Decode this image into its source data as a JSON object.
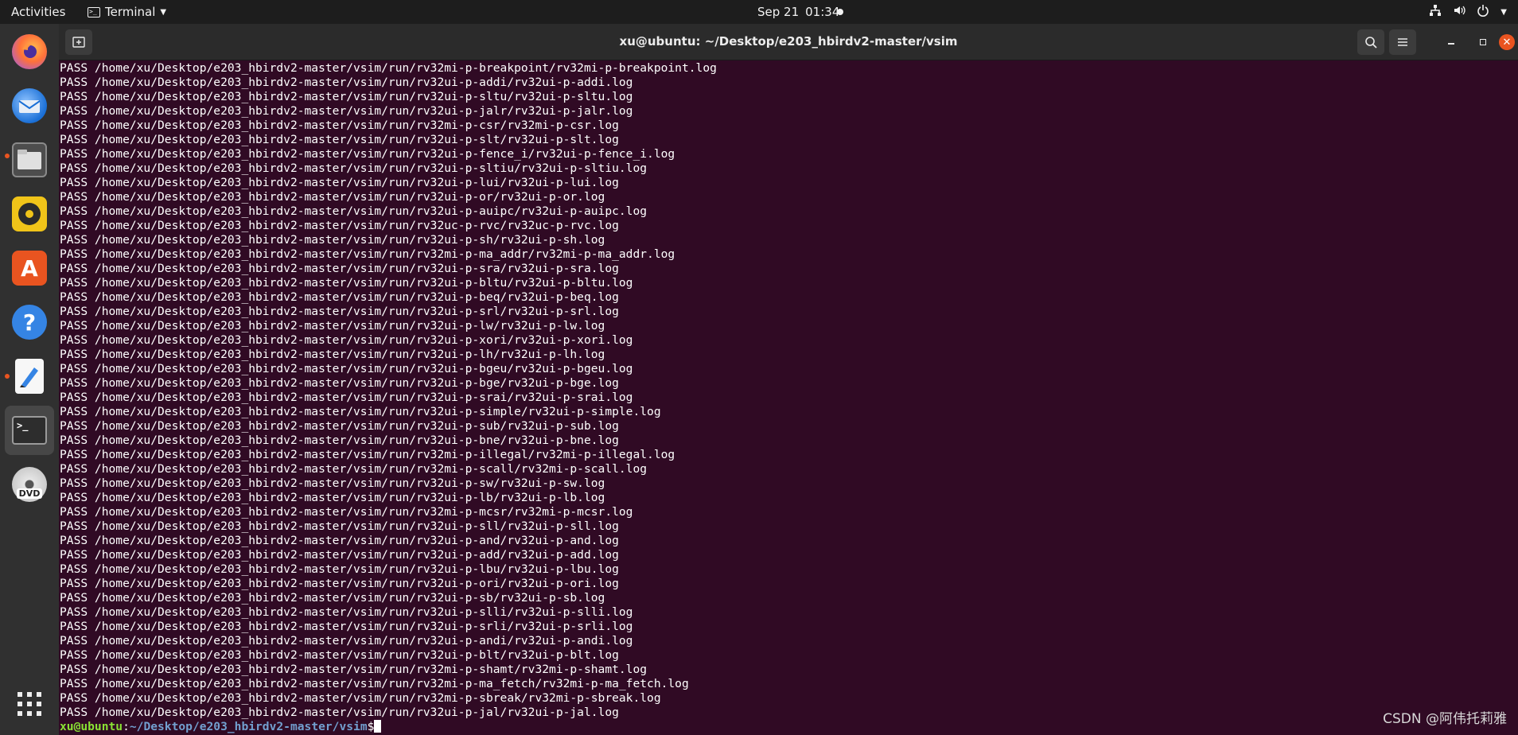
{
  "topbar": {
    "activities": "Activities",
    "app_name": "Terminal",
    "date": "Sep 21",
    "time": "01:34"
  },
  "dock": {
    "items": [
      {
        "name": "firefox",
        "icon": "firefox-icon"
      },
      {
        "name": "thunderbird",
        "icon": "thunderbird-icon"
      },
      {
        "name": "files",
        "icon": "files-icon"
      },
      {
        "name": "rhythmbox",
        "icon": "rhythmbox-icon"
      },
      {
        "name": "software",
        "icon": "software-center-icon"
      },
      {
        "name": "help",
        "icon": "help-icon"
      },
      {
        "name": "text-editor",
        "icon": "text-editor-icon"
      },
      {
        "name": "terminal",
        "icon": "terminal-icon"
      },
      {
        "name": "dvd",
        "icon": "dvd-icon"
      },
      {
        "name": "app-grid",
        "icon": "app-grid-icon"
      }
    ],
    "dvd_label": "DVD",
    "terminal_glyph": ">_"
  },
  "window": {
    "title": "xu@ubuntu: ~/Desktop/e203_hbirdv2-master/vsim"
  },
  "terminal": {
    "lines": [
      "PASS /home/xu/Desktop/e203_hbirdv2-master/vsim/run/rv32mi-p-breakpoint/rv32mi-p-breakpoint.log",
      "PASS /home/xu/Desktop/e203_hbirdv2-master/vsim/run/rv32ui-p-addi/rv32ui-p-addi.log",
      "PASS /home/xu/Desktop/e203_hbirdv2-master/vsim/run/rv32ui-p-sltu/rv32ui-p-sltu.log",
      "PASS /home/xu/Desktop/e203_hbirdv2-master/vsim/run/rv32ui-p-jalr/rv32ui-p-jalr.log",
      "PASS /home/xu/Desktop/e203_hbirdv2-master/vsim/run/rv32mi-p-csr/rv32mi-p-csr.log",
      "PASS /home/xu/Desktop/e203_hbirdv2-master/vsim/run/rv32ui-p-slt/rv32ui-p-slt.log",
      "PASS /home/xu/Desktop/e203_hbirdv2-master/vsim/run/rv32ui-p-fence_i/rv32ui-p-fence_i.log",
      "PASS /home/xu/Desktop/e203_hbirdv2-master/vsim/run/rv32ui-p-sltiu/rv32ui-p-sltiu.log",
      "PASS /home/xu/Desktop/e203_hbirdv2-master/vsim/run/rv32ui-p-lui/rv32ui-p-lui.log",
      "PASS /home/xu/Desktop/e203_hbirdv2-master/vsim/run/rv32ui-p-or/rv32ui-p-or.log",
      "PASS /home/xu/Desktop/e203_hbirdv2-master/vsim/run/rv32ui-p-auipc/rv32ui-p-auipc.log",
      "PASS /home/xu/Desktop/e203_hbirdv2-master/vsim/run/rv32uc-p-rvc/rv32uc-p-rvc.log",
      "PASS /home/xu/Desktop/e203_hbirdv2-master/vsim/run/rv32ui-p-sh/rv32ui-p-sh.log",
      "PASS /home/xu/Desktop/e203_hbirdv2-master/vsim/run/rv32mi-p-ma_addr/rv32mi-p-ma_addr.log",
      "PASS /home/xu/Desktop/e203_hbirdv2-master/vsim/run/rv32ui-p-sra/rv32ui-p-sra.log",
      "PASS /home/xu/Desktop/e203_hbirdv2-master/vsim/run/rv32ui-p-bltu/rv32ui-p-bltu.log",
      "PASS /home/xu/Desktop/e203_hbirdv2-master/vsim/run/rv32ui-p-beq/rv32ui-p-beq.log",
      "PASS /home/xu/Desktop/e203_hbirdv2-master/vsim/run/rv32ui-p-srl/rv32ui-p-srl.log",
      "PASS /home/xu/Desktop/e203_hbirdv2-master/vsim/run/rv32ui-p-lw/rv32ui-p-lw.log",
      "PASS /home/xu/Desktop/e203_hbirdv2-master/vsim/run/rv32ui-p-xori/rv32ui-p-xori.log",
      "PASS /home/xu/Desktop/e203_hbirdv2-master/vsim/run/rv32ui-p-lh/rv32ui-p-lh.log",
      "PASS /home/xu/Desktop/e203_hbirdv2-master/vsim/run/rv32ui-p-bgeu/rv32ui-p-bgeu.log",
      "PASS /home/xu/Desktop/e203_hbirdv2-master/vsim/run/rv32ui-p-bge/rv32ui-p-bge.log",
      "PASS /home/xu/Desktop/e203_hbirdv2-master/vsim/run/rv32ui-p-srai/rv32ui-p-srai.log",
      "PASS /home/xu/Desktop/e203_hbirdv2-master/vsim/run/rv32ui-p-simple/rv32ui-p-simple.log",
      "PASS /home/xu/Desktop/e203_hbirdv2-master/vsim/run/rv32ui-p-sub/rv32ui-p-sub.log",
      "PASS /home/xu/Desktop/e203_hbirdv2-master/vsim/run/rv32ui-p-bne/rv32ui-p-bne.log",
      "PASS /home/xu/Desktop/e203_hbirdv2-master/vsim/run/rv32mi-p-illegal/rv32mi-p-illegal.log",
      "PASS /home/xu/Desktop/e203_hbirdv2-master/vsim/run/rv32mi-p-scall/rv32mi-p-scall.log",
      "PASS /home/xu/Desktop/e203_hbirdv2-master/vsim/run/rv32ui-p-sw/rv32ui-p-sw.log",
      "PASS /home/xu/Desktop/e203_hbirdv2-master/vsim/run/rv32ui-p-lb/rv32ui-p-lb.log",
      "PASS /home/xu/Desktop/e203_hbirdv2-master/vsim/run/rv32mi-p-mcsr/rv32mi-p-mcsr.log",
      "PASS /home/xu/Desktop/e203_hbirdv2-master/vsim/run/rv32ui-p-sll/rv32ui-p-sll.log",
      "PASS /home/xu/Desktop/e203_hbirdv2-master/vsim/run/rv32ui-p-and/rv32ui-p-and.log",
      "PASS /home/xu/Desktop/e203_hbirdv2-master/vsim/run/rv32ui-p-add/rv32ui-p-add.log",
      "PASS /home/xu/Desktop/e203_hbirdv2-master/vsim/run/rv32ui-p-lbu/rv32ui-p-lbu.log",
      "PASS /home/xu/Desktop/e203_hbirdv2-master/vsim/run/rv32ui-p-ori/rv32ui-p-ori.log",
      "PASS /home/xu/Desktop/e203_hbirdv2-master/vsim/run/rv32ui-p-sb/rv32ui-p-sb.log",
      "PASS /home/xu/Desktop/e203_hbirdv2-master/vsim/run/rv32ui-p-slli/rv32ui-p-slli.log",
      "PASS /home/xu/Desktop/e203_hbirdv2-master/vsim/run/rv32ui-p-srli/rv32ui-p-srli.log",
      "PASS /home/xu/Desktop/e203_hbirdv2-master/vsim/run/rv32ui-p-andi/rv32ui-p-andi.log",
      "PASS /home/xu/Desktop/e203_hbirdv2-master/vsim/run/rv32ui-p-blt/rv32ui-p-blt.log",
      "PASS /home/xu/Desktop/e203_hbirdv2-master/vsim/run/rv32mi-p-shamt/rv32mi-p-shamt.log",
      "PASS /home/xu/Desktop/e203_hbirdv2-master/vsim/run/rv32mi-p-ma_fetch/rv32mi-p-ma_fetch.log",
      "PASS /home/xu/Desktop/e203_hbirdv2-master/vsim/run/rv32mi-p-sbreak/rv32mi-p-sbreak.log",
      "PASS /home/xu/Desktop/e203_hbirdv2-master/vsim/run/rv32ui-p-jal/rv32ui-p-jal.log"
    ],
    "prompt_user": "xu@ubuntu",
    "prompt_sep": ":",
    "prompt_path": "~/Desktop/e203_hbirdv2-master/vsim",
    "prompt_symbol": "$"
  },
  "watermark": "CSDN @阿伟托莉雅",
  "colors": {
    "terminal_bg": "#300a24",
    "prompt_user": "#8ae234",
    "prompt_path": "#729fcf",
    "accent": "#e95420"
  }
}
